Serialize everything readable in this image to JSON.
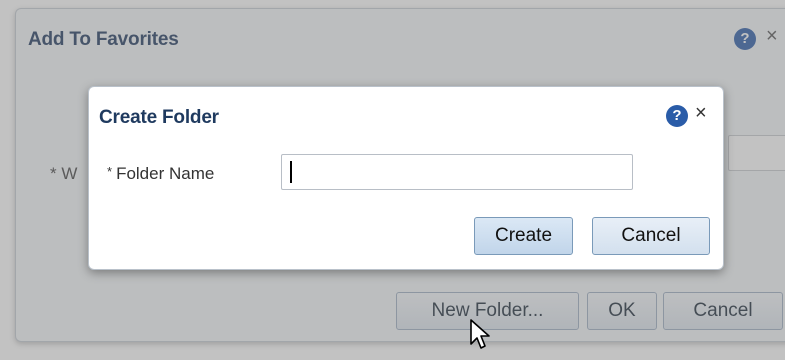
{
  "background_dialog": {
    "title": "Add To Favorites",
    "help_icon": "?",
    "close_icon": "×",
    "field_label_partial": "* W",
    "buttons": {
      "new_folder": "New Folder...",
      "ok": "OK",
      "cancel": "Cancel"
    }
  },
  "create_folder_dialog": {
    "title": "Create Folder",
    "help_icon": "?",
    "close_icon": "×",
    "required_marker": "*",
    "folder_name_label": "Folder Name",
    "folder_name_value": "",
    "buttons": {
      "create": "Create",
      "cancel": "Cancel"
    }
  },
  "icons": {
    "help": "question-circle-icon",
    "close": "close-icon",
    "pointer": "mouse-pointer-icon"
  },
  "colors": {
    "title_text": "#1f3a5f",
    "help_icon_bg": "#2a5ca8",
    "button_border": "#7a9ab9"
  }
}
